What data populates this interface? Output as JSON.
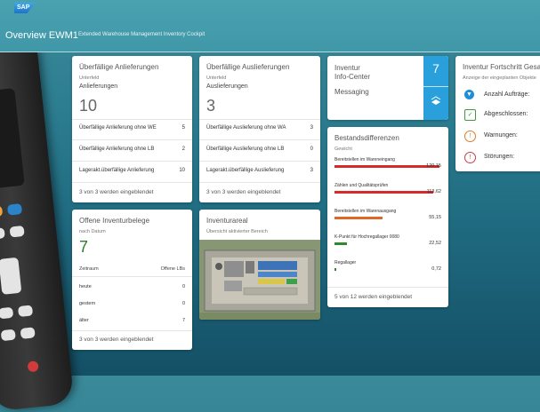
{
  "header": {
    "logo": "SAP",
    "title": "Overview EWM1",
    "subtitle": "Extended Warehouse Management Inventory Cockpit"
  },
  "overdue_inbound": {
    "title": "Überfällige Anlieferungen",
    "sub": "Unterfeld",
    "label": "Anlieferungen",
    "kpi": "10",
    "rows": [
      {
        "label": "Überfällige Anlieferung ohne WE",
        "value": "5"
      },
      {
        "label": "Überfällige Anlieferung ohne LB",
        "value": "2"
      },
      {
        "label": "Lagerakt.überfällige Anlieferung",
        "value": "10"
      }
    ],
    "footer": "3 von 3 werden eingeblendet"
  },
  "overdue_outbound": {
    "title": "Überfällige Auslieferungen",
    "sub": "Unterfeld",
    "label": "Auslieferungen",
    "kpi": "3",
    "rows": [
      {
        "label": "Überfällige Auslieferung ohne WA",
        "value": "3"
      },
      {
        "label": "Überfällige Auslieferung ohne LB",
        "value": "0"
      },
      {
        "label": "Lagerakt.überfällige Auslieferung",
        "value": "3"
      }
    ],
    "footer": "3 von 3 werden eingeblendet"
  },
  "inventory_info": {
    "title_line1": "Inventur",
    "title_line2": "Info-Center",
    "count": "7",
    "messaging": "Messaging"
  },
  "inventory_progress": {
    "title": "Inventur Fortschritt Gesa",
    "sub": "Anzeige der eingeplanten Objekte",
    "items": [
      {
        "label": "Anzahl Aufträge:",
        "icon": "funnel-icon",
        "color": "#1f8ed6"
      },
      {
        "label": "Abgeschlossen:",
        "icon": "check-icon",
        "color": "#3a9d3a"
      },
      {
        "label": "Warnungen:",
        "icon": "warning-icon",
        "color": "#e07b2a"
      },
      {
        "label": "Störungen:",
        "icon": "error-icon",
        "color": "#d23b3b"
      }
    ]
  },
  "open_counts": {
    "title": "Offene Inventurbelege",
    "sub": "nach Datum",
    "kpi": "7",
    "col_left": "Zeitraum",
    "col_right": "Offene LBs",
    "rows": [
      {
        "label": "heute",
        "value": "0"
      },
      {
        "label": "gestern",
        "value": "0"
      },
      {
        "label": "älter",
        "value": "7"
      }
    ],
    "footer": "3 von 3 werden eingeblendet"
  },
  "inventory_area": {
    "title": "Inventurareal",
    "sub": "Übersicht aktivierter Bereich"
  },
  "stock_diff": {
    "title": "Bestandsdifferenzen",
    "sub": "Gewicht",
    "rows": [
      {
        "label": "Bereitstellen im Wareneingang",
        "value": "120,15",
        "fraction": 1.0,
        "color": "#d42b2b"
      },
      {
        "label": "Zählen und Qualitätsprüfen",
        "value": "113,62",
        "fraction": 0.94,
        "color": "#d42b2b"
      },
      {
        "label": "Bereitstellen im Warenausgang",
        "value": "55,15",
        "fraction": 0.46,
        "color": "#e0662a"
      },
      {
        "label": "K-Punkt für Hochregallager 0080",
        "value": "22,52",
        "fraction": 0.12,
        "color": "#2f8a2f"
      },
      {
        "label": "Regallager",
        "value": "0,72",
        "fraction": 0.01,
        "color": "#2f8a2f"
      }
    ],
    "footer": "5 von 12 werden eingeblendet"
  }
}
